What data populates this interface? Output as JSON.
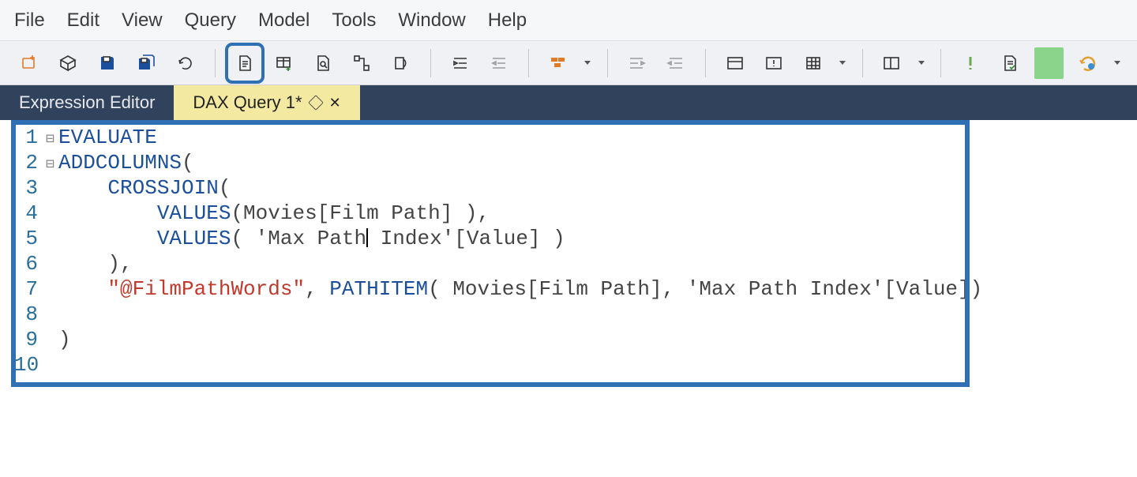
{
  "menu": {
    "items": [
      "File",
      "Edit",
      "View",
      "Query",
      "Model",
      "Tools",
      "Window",
      "Help"
    ]
  },
  "tabs": {
    "expression": "Expression Editor",
    "query_label": "DAX Query 1*"
  },
  "code": {
    "line_numbers": [
      "1",
      "2",
      "3",
      "4",
      "5",
      "6",
      "7",
      "8",
      "9",
      "10"
    ],
    "fold_markers": [
      "",
      "⊟",
      "⊟",
      "",
      "",
      "",
      "",
      "",
      "",
      ""
    ],
    "lines": [
      [
        {
          "cls": "kw",
          "t": "EVALUATE"
        }
      ],
      [
        {
          "cls": "kw",
          "t": "ADDCOLUMNS"
        },
        {
          "cls": "txt",
          "t": "("
        }
      ],
      [
        {
          "cls": "txt",
          "t": "    "
        },
        {
          "cls": "kw",
          "t": "CROSSJOIN"
        },
        {
          "cls": "txt",
          "t": "("
        }
      ],
      [
        {
          "cls": "txt",
          "t": "        "
        },
        {
          "cls": "kw",
          "t": "VALUES"
        },
        {
          "cls": "txt",
          "t": "(Movies[Film Path] ),"
        }
      ],
      [
        {
          "cls": "txt",
          "t": "        "
        },
        {
          "cls": "kw",
          "t": "VALUES"
        },
        {
          "cls": "txt",
          "t": "( 'Max Path"
        },
        {
          "cls": "caret",
          "caret": true
        },
        {
          "cls": "txt",
          "t": " Index'[Value] )"
        }
      ],
      [
        {
          "cls": "txt",
          "t": "    ),"
        }
      ],
      [
        {
          "cls": "txt",
          "t": "    "
        },
        {
          "cls": "str",
          "t": "\"@FilmPathWords\""
        },
        {
          "cls": "txt",
          "t": ", "
        },
        {
          "cls": "kw",
          "t": "PATHITEM"
        },
        {
          "cls": "txt",
          "t": "( Movies[Film Path], 'Max Path Index'[Value])"
        }
      ],
      [
        {
          "cls": "txt",
          "t": ""
        }
      ],
      [
        {
          "cls": "txt",
          "t": ")"
        }
      ],
      [
        {
          "cls": "txt",
          "t": ""
        }
      ]
    ]
  },
  "toolbar_icons": [
    "new-file-icon",
    "cube-icon",
    "save-icon",
    "save-all-icon",
    "refresh-icon",
    "document-icon",
    "add-table-icon",
    "zoom-fit-icon",
    "relation-icon",
    "rotate-icon",
    "indent-icon",
    "outdent-icon",
    "brick-icon",
    "align1-icon",
    "align2-icon",
    "panel-icon",
    "panel-warn-icon",
    "grid-icon",
    "panel2-icon",
    "warn-icon",
    "doc-check-icon",
    "green-square-icon",
    "run-icon"
  ]
}
